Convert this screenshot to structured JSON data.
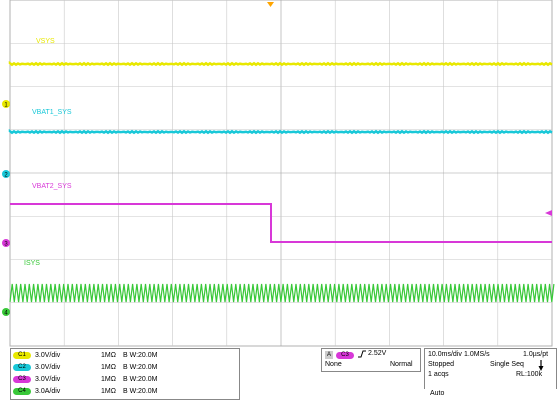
{
  "channels": [
    {
      "id": "1",
      "chip": "C1",
      "color": "#e8e800",
      "label": "VSYS",
      "scale": "3.0V/div",
      "impedance": "1MΩ",
      "bw": "B W:20.0M"
    },
    {
      "id": "2",
      "chip": "C2",
      "color": "#19c8d8",
      "label": "VBAT1_SYS",
      "scale": "3.0V/div",
      "impedance": "1MΩ",
      "bw": "B W:20.0M"
    },
    {
      "id": "3",
      "chip": "C3",
      "color": "#d838d8",
      "label": "VBAT2_SYS",
      "scale": "3.0V/div",
      "impedance": "1MΩ",
      "bw": "B W:20.0M"
    },
    {
      "id": "4",
      "chip": "C4",
      "color": "#38c838",
      "label": "ISYS",
      "scale": "3.0A/div",
      "impedance": "1MΩ",
      "bw": "B W:20.0M"
    }
  ],
  "trigger": {
    "source_chip": "C3",
    "letter": "A",
    "level": "2.52V",
    "mode_left": "None",
    "mode_right": "Normal"
  },
  "acquisition": {
    "timebase": "10.0ms/div",
    "rate": "1.0MS/s",
    "resolution": "1.0µs/pt",
    "state": "Stopped",
    "seq": "Single Seq",
    "acqs": "1 acqs",
    "record": "RL:100k",
    "mode": "Auto"
  },
  "colors": {
    "grid": "#c8c8c8",
    "trigger_marker": "#ffa500"
  }
}
